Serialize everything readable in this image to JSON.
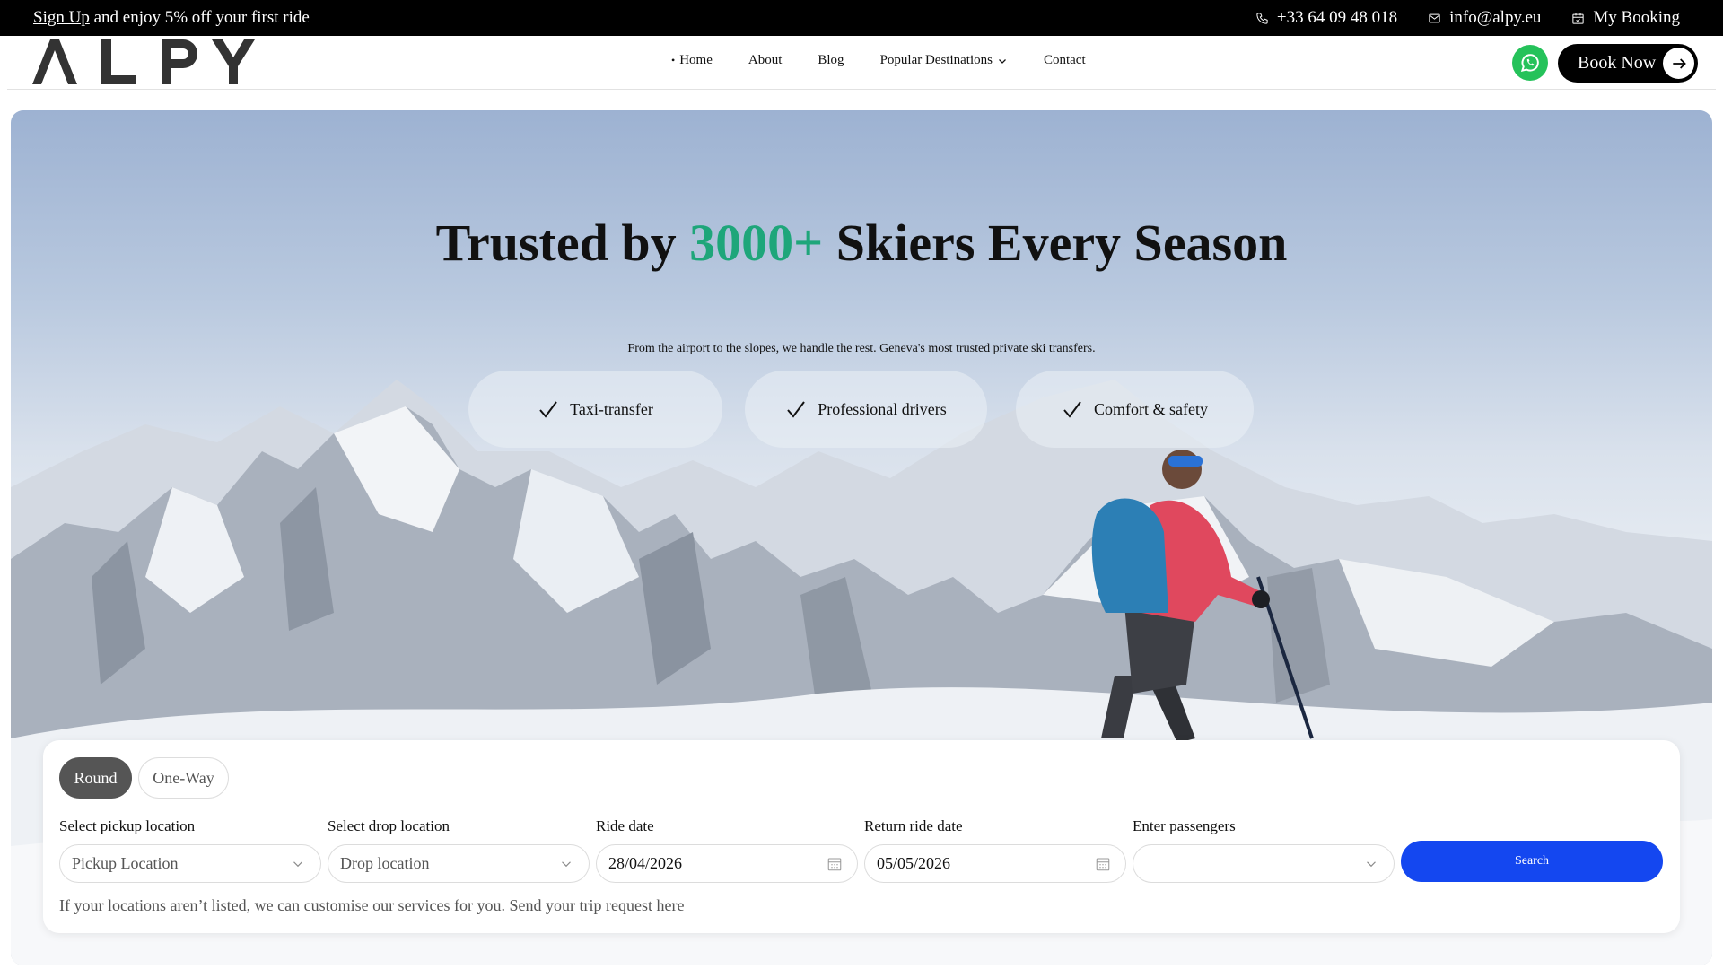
{
  "topbar": {
    "promo_link": "Sign Up",
    "promo_text": " and enjoy 5% off your first ride",
    "phone": "+33 64 09 48 018",
    "email": "info@alpy.eu",
    "booking": "My Booking"
  },
  "brand": {
    "logo": "ALPY"
  },
  "nav": {
    "home": "Home",
    "about": "About",
    "blog": "Blog",
    "destinations": "Popular Destinations",
    "contact": "Contact"
  },
  "cta": {
    "book_now": "Book Now"
  },
  "hero": {
    "headline_1": "Trusted by ",
    "headline_highlight": "3000+",
    "headline_2": " Skiers Every Season",
    "subline": "From the airport to the slopes, we handle the rest. Geneva's most trusted private ski transfers.",
    "features": [
      "Taxi-transfer",
      "Professional drivers",
      "Comfort & safety"
    ]
  },
  "booking": {
    "tabs": [
      "Round",
      "One-Way"
    ],
    "active_tab": "Round",
    "pickup": {
      "label": "Select pickup location",
      "placeholder": "Pickup Location"
    },
    "drop": {
      "label": "Select drop location",
      "placeholder": "Drop location"
    },
    "ride_date": {
      "label": "Ride date",
      "value": "28/04/2026"
    },
    "return_date": {
      "label": "Return ride date",
      "value": "05/05/2026"
    },
    "passengers": {
      "label": "Enter passengers",
      "value": ""
    },
    "search": "Search",
    "note_text": "If your locations aren’t listed, we can customise our services for you. Send your trip request ",
    "note_link": "here"
  },
  "colors": {
    "accent_green": "#1ea67a",
    "search_blue": "#1447f0",
    "whatsapp": "#25c25a"
  }
}
